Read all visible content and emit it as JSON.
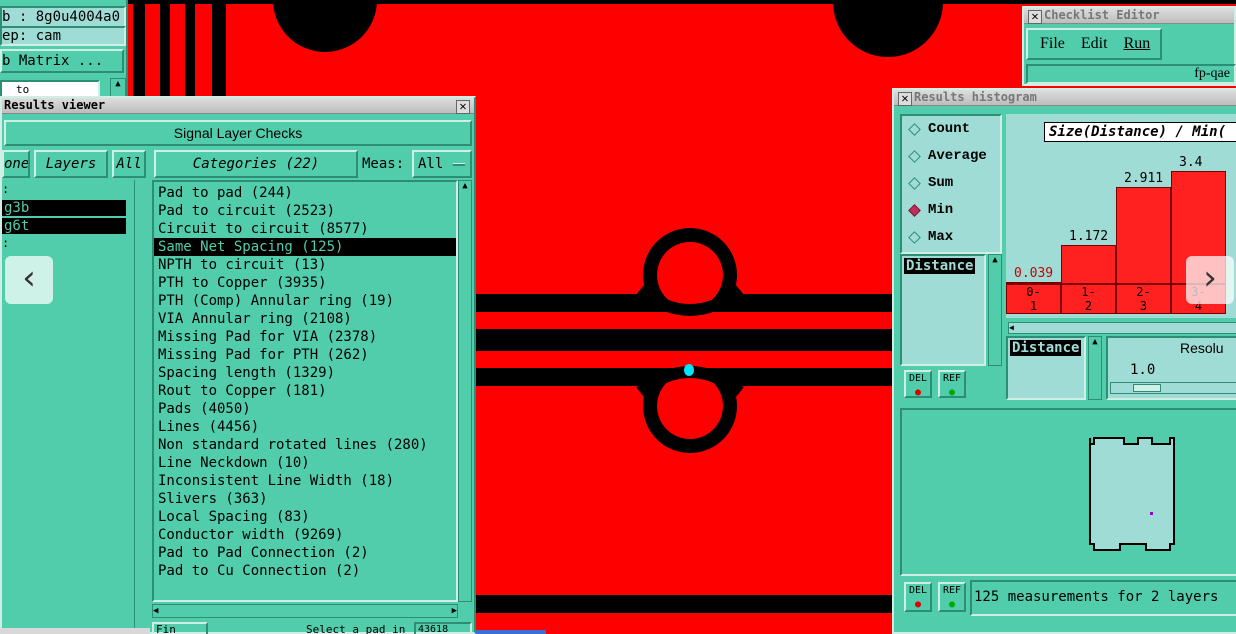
{
  "job_panel": {
    "job_text": "b : 8g0u4004a0",
    "step_text": "ep: cam",
    "matrix_button": "b Matrix ...",
    "combo_value": "to"
  },
  "results_viewer": {
    "title": "Results viewer",
    "header": "Signal Layer Checks",
    "none_button": "one",
    "layers_button": "Layers",
    "all_button": "All",
    "categories_button": "Categories (22)",
    "meas_label": "Meas:",
    "meas_value": "All",
    "layers": [
      "g3b",
      "g6t"
    ],
    "categories": [
      "Pad to pad (244)",
      "Pad to circuit (2523)",
      "Circuit to circuit (8577)",
      "Same Net Spacing (125)",
      "NPTH to circuit (13)",
      "PTH to Copper (3935)",
      "PTH (Comp) Annular ring (19)",
      "VIA Annular ring (2108)",
      "Missing Pad for VIA (2378)",
      "Missing Pad for PTH (262)",
      "Spacing length (1329)",
      "Rout to Copper (181)",
      "Pads (4050)",
      "Lines (4456)",
      "Non standard rotated lines (280)",
      "Line Neckdown (10)",
      "Inconsistent Line Width (18)",
      "Slivers (363)",
      "Local Spacing (83)",
      "Conductor width (9269)",
      "Pad to Pad Connection (2)",
      "Pad to Cu Connection (2)"
    ],
    "selected_index": 3,
    "bottom_left": "Fin",
    "bottom_status": "Select a pad in the work",
    "bottom_coord": "43618"
  },
  "checklist_editor": {
    "title": "Checklist Editor",
    "menu": [
      "File",
      "Edit",
      "Run"
    ],
    "name": "fp-qae"
  },
  "histogram": {
    "title": "Results histogram",
    "function_options": [
      "Count",
      "Average",
      "Sum",
      "Min",
      "Max"
    ],
    "selected_function": "Min",
    "graph_title": "Size(Distance) / Min(",
    "list_item": "Distance",
    "axis_field": "Distance",
    "resolution_label": "Resolu",
    "resolution_value": "1.0",
    "del_label": "DEL",
    "ref_label": "REF",
    "status": "125 measurements for 2 layers",
    "chart_data": {
      "type": "bar",
      "categories": [
        "0-1",
        "1-2",
        "2-3",
        "3-4"
      ],
      "values": [
        0.039,
        1.172,
        2.911,
        3.4
      ],
      "value_labels": [
        "0.039",
        "1.172",
        "2.911",
        "3.4"
      ],
      "bins_top": [
        "0-",
        "1-",
        "2-",
        "3-"
      ],
      "bins_bottom": [
        "1",
        "2",
        "3",
        "4"
      ],
      "ylim": [
        0,
        4.2
      ]
    }
  },
  "nav": {
    "prev": "‹",
    "next": "›"
  },
  "colors": {
    "copper": "#ff0000",
    "panel": "#51cdab",
    "panel_light": "#9fdcd6",
    "bar": "#ff2020"
  }
}
